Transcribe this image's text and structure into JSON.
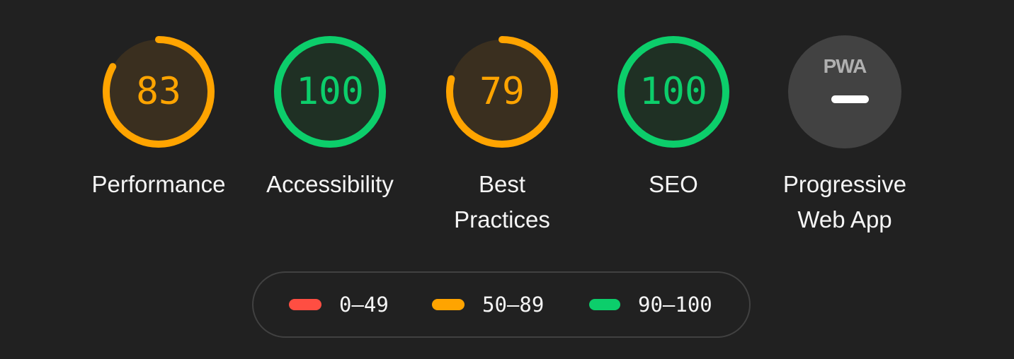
{
  "categories": [
    {
      "id": "performance",
      "label": "Performance",
      "score": "83",
      "value": 83,
      "status": "average"
    },
    {
      "id": "accessibility",
      "label": "Accessibility",
      "score": "100",
      "value": 100,
      "status": "pass"
    },
    {
      "id": "best-practices",
      "label": "Best Practices",
      "score": "79",
      "value": 79,
      "status": "average"
    },
    {
      "id": "seo",
      "label": "SEO",
      "score": "100",
      "value": 100,
      "status": "pass"
    },
    {
      "id": "pwa",
      "label": "Progressive Web App",
      "logo": "PWA",
      "status": "na"
    }
  ],
  "colors": {
    "fail": "#ff4e42",
    "average": "#ffa400",
    "pass": "#0cce6b",
    "average_bg": "#3a2f1f",
    "pass_bg": "#1f3024",
    "na_bg": "#424242"
  },
  "legend": [
    {
      "range": "0–49",
      "status": "fail"
    },
    {
      "range": "50–89",
      "status": "average"
    },
    {
      "range": "90–100",
      "status": "pass"
    }
  ]
}
